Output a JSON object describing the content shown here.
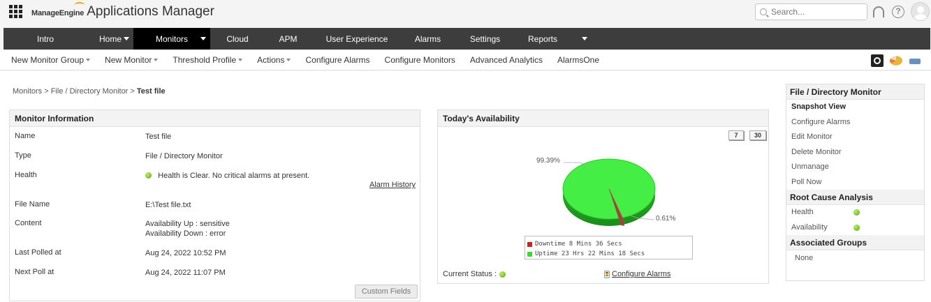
{
  "header": {
    "brand_vendor": "ManageEngine",
    "brand_product": "Applications Manager",
    "search_placeholder": "Search...",
    "help_glyph": "?"
  },
  "main_nav": [
    {
      "label": "Intro",
      "active": false,
      "caret": false
    },
    {
      "label": "Home",
      "active": false,
      "caret": true
    },
    {
      "label": "Monitors",
      "active": true,
      "caret": true
    },
    {
      "label": "Cloud",
      "active": false,
      "caret": false
    },
    {
      "label": "APM",
      "active": false,
      "caret": false
    },
    {
      "label": "User Experience",
      "active": false,
      "caret": false
    },
    {
      "label": "Alarms",
      "active": false,
      "caret": false
    },
    {
      "label": "Settings",
      "active": false,
      "caret": false
    },
    {
      "label": "Reports",
      "active": false,
      "caret": true
    }
  ],
  "sub_nav": [
    {
      "label": "New Monitor Group",
      "caret": true
    },
    {
      "label": "New Monitor",
      "caret": true
    },
    {
      "label": "Threshold Profile",
      "caret": true
    },
    {
      "label": "Actions",
      "caret": true
    },
    {
      "label": "Configure Alarms",
      "caret": false
    },
    {
      "label": "Configure Monitors",
      "caret": false
    },
    {
      "label": "Advanced Analytics",
      "caret": false
    },
    {
      "label": "AlarmsOne",
      "caret": false
    }
  ],
  "breadcrumb": {
    "path": "Monitors > File / Directory Monitor > ",
    "current": "Test file"
  },
  "monitor_info": {
    "title": "Monitor Information",
    "name_label": "Name",
    "name_value": "Test file",
    "type_label": "Type",
    "type_value": "File / Directory Monitor",
    "health_label": "Health",
    "health_value": "Health is Clear. No critical alarms at present.",
    "alarm_history": "Alarm History",
    "file_label": "File Name",
    "file_value": "E:\\Test file.txt",
    "content_label": "Content",
    "content_up": "Availability Up : sensitive",
    "content_down": "Availability Down : error",
    "last_polled_label": "Last Polled at",
    "last_polled_value": "Aug 24, 2022 10:52 PM",
    "next_poll_label": "Next Poll at",
    "next_poll_value": "Aug 24, 2022 11:07 PM",
    "custom_fields": "Custom Fields"
  },
  "availability": {
    "title": "Today's Availability",
    "period_7": "7",
    "period_30": "30",
    "uptime_pct_label": "99.39%",
    "downtime_pct_label": "0.61%",
    "legend_downtime": "Downtime 8 Mins 36 Secs",
    "legend_uptime": "Uptime 23 Hrs 22 Mins 18 Secs",
    "current_status": "Current Status :",
    "configure_alarms": "Configure Alarms",
    "colors": {
      "uptime": "#33dd33",
      "downtime": "#cc2222"
    }
  },
  "sidebar": {
    "section1": "File / Directory Monitor",
    "items": [
      "Snapshot View",
      "Configure Alarms",
      "Edit Monitor",
      "Delete Monitor",
      "Unmanage",
      "Poll Now"
    ],
    "section2": "Root Cause Analysis",
    "rca_health": "Health",
    "rca_availability": "Availability",
    "section3": "Associated Groups",
    "groups_value": "None"
  }
}
